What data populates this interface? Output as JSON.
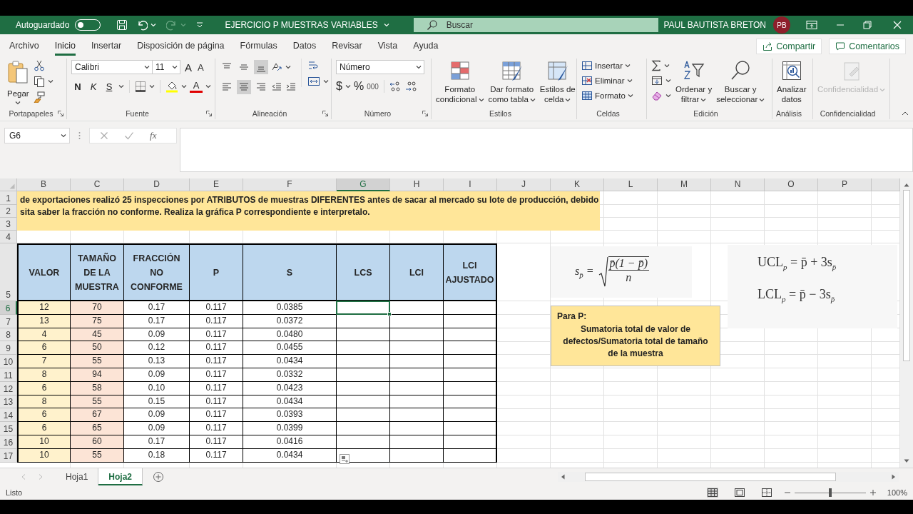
{
  "title_bar": {
    "autosave": {
      "label": "Autoguardado",
      "on": false
    },
    "document_title": "EJERCICIO P MUESTRAS VARIABLES",
    "search": {
      "placeholder": "Buscar"
    },
    "user": {
      "name": "PAUL BAUTISTA BRETON",
      "initials": "PB"
    }
  },
  "ribbon_tabs": [
    {
      "label": "Archivo",
      "selected": false
    },
    {
      "label": "Inicio",
      "selected": true
    },
    {
      "label": "Insertar",
      "selected": false
    },
    {
      "label": "Disposición de página",
      "selected": false
    },
    {
      "label": "Fórmulas",
      "selected": false
    },
    {
      "label": "Datos",
      "selected": false
    },
    {
      "label": "Revisar",
      "selected": false
    },
    {
      "label": "Vista",
      "selected": false
    },
    {
      "label": "Ayuda",
      "selected": false
    }
  ],
  "ribbon_actions": [
    "Compartir",
    "Comentarios"
  ],
  "ribbon": {
    "clipboard": {
      "paste": "Pegar",
      "label": "Portapapeles"
    },
    "font": {
      "font_name": "Calibri",
      "font_size": "11",
      "grow": "A",
      "shrink": "A",
      "bold": "N",
      "italic": "K",
      "underline": "S",
      "font_color": "A",
      "label": "Fuente"
    },
    "alignment": {
      "vertical_align": [
        {
          "selected": false
        },
        {
          "selected": false
        },
        {
          "selected": true
        }
      ],
      "horizontal_align": [
        {
          "selected": false
        },
        {
          "selected": true
        },
        {
          "selected": false
        }
      ],
      "label": "Alineación"
    },
    "number": {
      "format": "Número",
      "currency": "$",
      "percent": "%",
      "thousands": "000",
      "label": "Número"
    },
    "styles": {
      "buttons": [
        [
          "Formato",
          "condicional"
        ],
        [
          "Dar formato",
          "como tabla"
        ],
        [
          "Estilos de",
          "celda"
        ]
      ],
      "label": "Estilos"
    },
    "cells": {
      "buttons": [
        "Insertar",
        "Eliminar",
        "Formato"
      ],
      "label": "Celdas"
    },
    "editing": {
      "buttons": [
        [
          "Ordenar y",
          "filtrar"
        ],
        [
          "Buscar y",
          "seleccionar"
        ]
      ],
      "label": "Edición"
    },
    "analysis": {
      "button": [
        "Analizar",
        "datos"
      ],
      "label": "Análisis"
    },
    "sensitivity": {
      "button": "Confidencialidad",
      "disabled": true,
      "label": "Confidencialidad"
    }
  },
  "name_box": "G6",
  "formula_bar": {
    "fx": "fx"
  },
  "sheet": {
    "columns": [
      {
        "label": "B",
        "selected": false
      },
      {
        "label": "C",
        "selected": false
      },
      {
        "label": "D",
        "selected": false
      },
      {
        "label": "E",
        "selected": false
      },
      {
        "label": "F",
        "selected": false
      },
      {
        "label": "G",
        "selected": true
      },
      {
        "label": "H",
        "selected": false
      },
      {
        "label": "I",
        "selected": false
      },
      {
        "label": "J",
        "selected": false
      },
      {
        "label": "K",
        "selected": false
      },
      {
        "label": "L",
        "selected": false
      },
      {
        "label": "M",
        "selected": false
      },
      {
        "label": "N",
        "selected": false
      },
      {
        "label": "O",
        "selected": false
      },
      {
        "label": "P",
        "selected": false
      }
    ],
    "row_headers": [
      {
        "label": "1",
        "selected": false
      },
      {
        "label": "2",
        "selected": false
      },
      {
        "label": "3",
        "selected": false
      },
      {
        "label": "4",
        "selected": false
      },
      {
        "label": "5",
        "selected": false
      },
      {
        "label": "6",
        "selected": true
      },
      {
        "label": "7",
        "selected": false
      },
      {
        "label": "8",
        "selected": false
      },
      {
        "label": "9",
        "selected": false
      },
      {
        "label": "10",
        "selected": false
      },
      {
        "label": "11",
        "selected": false
      },
      {
        "label": "12",
        "selected": false
      },
      {
        "label": "13",
        "selected": false
      },
      {
        "label": "14",
        "selected": false
      },
      {
        "label": "15",
        "selected": false
      },
      {
        "label": "16",
        "selected": false
      },
      {
        "label": "17",
        "selected": false
      }
    ],
    "instructions": [
      "de exportaciones realizó 25 inspecciones por ATRIBUTOS de muestras DIFERENTES antes de sacar al mercado su lote de producción, debido",
      "sita saber la fracción no conforme. Realiza la gráfica P correspondiente e interpretalo."
    ],
    "table": {
      "headers": [
        "VALOR",
        "TAMAÑO DE LA MUESTRA",
        "FRACCIÓN NO CONFORME",
        "P",
        "S",
        "LCS",
        "LCI",
        "LCI AJUSTADO"
      ],
      "rows": [
        [
          "12",
          "70",
          "0.17",
          "0.117",
          "0.0385"
        ],
        [
          "13",
          "75",
          "0.17",
          "0.117",
          "0.0372"
        ],
        [
          "4",
          "45",
          "0.09",
          "0.117",
          "0.0480"
        ],
        [
          "6",
          "50",
          "0.12",
          "0.117",
          "0.0455"
        ],
        [
          "7",
          "55",
          "0.13",
          "0.117",
          "0.0434"
        ],
        [
          "8",
          "94",
          "0.09",
          "0.117",
          "0.0332"
        ],
        [
          "6",
          "58",
          "0.10",
          "0.117",
          "0.0423"
        ],
        [
          "8",
          "55",
          "0.15",
          "0.117",
          "0.0434"
        ],
        [
          "6",
          "67",
          "0.09",
          "0.117",
          "0.0393"
        ],
        [
          "6",
          "65",
          "0.09",
          "0.117",
          "0.0399"
        ],
        [
          "10",
          "60",
          "0.17",
          "0.117",
          "0.0416"
        ],
        [
          "10",
          "55",
          "0.18",
          "0.117",
          "0.0434"
        ]
      ]
    },
    "formulas": {
      "std": {
        "lhs": "s$_{p̄}$ =",
        "numerator": "p̄(1 − p̄)",
        "denominator": "n"
      },
      "ucl": "UCL$_{p}$ = p̄ + 3s$_{p̄}$",
      "lcl": "LCL$_{p}$ = p̄ − 3s$_{p̄}$"
    },
    "note": {
      "title": "Para P:",
      "text": "Sumatoria total de valor de defectos/Sumatoria total de tamaño de la muestra"
    }
  },
  "sheet_tabs": [
    {
      "label": "Hoja1",
      "selected": false
    },
    {
      "label": "Hoja2",
      "selected": true
    }
  ],
  "status_bar": {
    "text": "Listo",
    "views": [
      {
        "selected": true
      },
      {
        "selected": false
      },
      {
        "selected": false
      }
    ],
    "zoom": {
      "level": 0.5,
      "reading": "100%"
    }
  }
}
